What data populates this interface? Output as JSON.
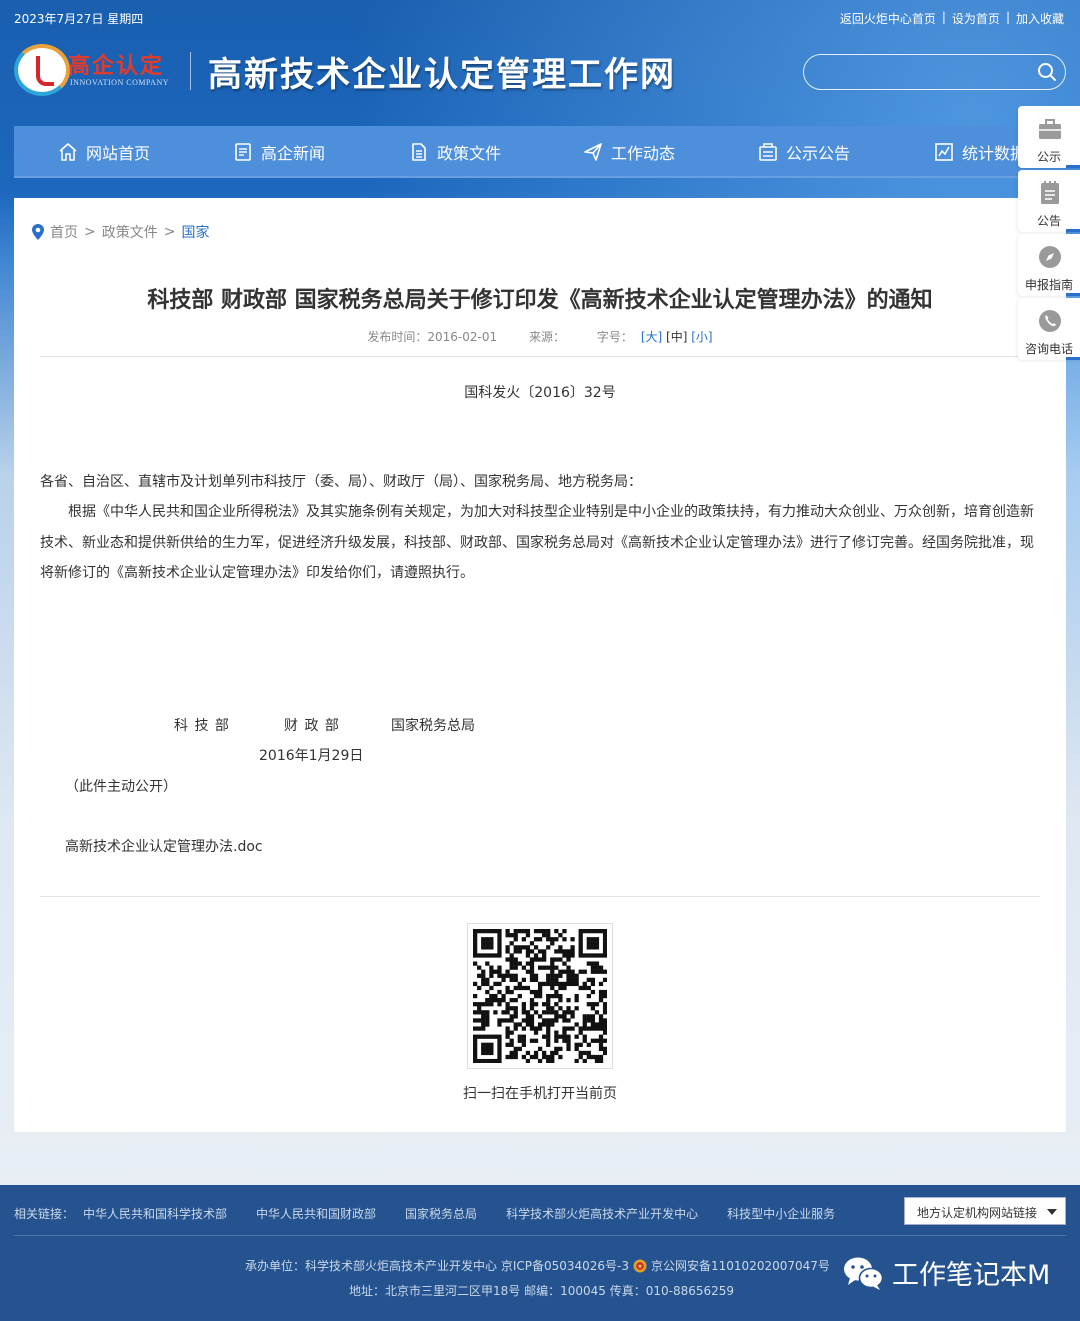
{
  "topbar": {
    "date": "2023年7月27日 星期四",
    "links": [
      "返回火炬中心首页",
      "设为首页",
      "加入收藏"
    ],
    "separator": "|"
  },
  "header": {
    "logo_cn": "高企认定",
    "logo_en": "INNOVATION COMPANY",
    "site_title": "高新技术企业认定管理工作网",
    "search_placeholder": ""
  },
  "nav": {
    "items": [
      {
        "label": "网站首页",
        "icon": "home-icon"
      },
      {
        "label": "高企新闻",
        "icon": "news-icon"
      },
      {
        "label": "政策文件",
        "icon": "document-icon"
      },
      {
        "label": "工作动态",
        "icon": "send-icon"
      },
      {
        "label": "公示公告",
        "icon": "notice-icon"
      },
      {
        "label": "统计数据",
        "icon": "chart-icon"
      }
    ]
  },
  "sidebar": {
    "items": [
      {
        "label": "公示",
        "icon": "briefcase-icon"
      },
      {
        "label": "公告",
        "icon": "clipboard-icon"
      },
      {
        "label": "申报指南",
        "icon": "compass-icon"
      },
      {
        "label": "咨询电话",
        "icon": "phone-icon"
      }
    ]
  },
  "breadcrumb": {
    "home": "首页",
    "section": "政策文件",
    "current": "国家",
    "separator": ">"
  },
  "article": {
    "title": "科技部 财政部 国家税务总局关于修订印发《高新技术企业认定管理办法》的通知",
    "publish_label": "发布时间：",
    "publish_date": "2016-02-01",
    "source_label": "来源：",
    "source": "",
    "font_label": "字号：",
    "font_sizes": [
      "[大]",
      "[中]",
      "[小]"
    ],
    "doc_number": "国科发火〔2016〕32号",
    "salutation": "各省、自治区、直辖市及计划单列市科技厅（委、局）、财政厅（局）、国家税务局、地方税务局：",
    "body": "根据《中华人民共和国企业所得税法》及其实施条例有关规定，为加大对科技型企业特别是中小企业的政策扶持，有力推动大众创业、万众创新，培育创造新技术、新业态和提供新供给的生力军，促进经济升级发展，科技部、财政部、国家税务总局对《高新技术企业认定管理办法》进行了修订完善。经国务院批准，现将新修订的《高新技术企业认定管理办法》印发给你们，请遵照执行。",
    "signatories": [
      "科 技 部",
      "财 政 部",
      "国家税务总局"
    ],
    "sign_date": "2016年1月29日",
    "disclosure": "（此件主动公开）",
    "attachment": "高新技术企业认定管理办法.doc",
    "qr_caption": "扫一扫在手机打开当前页"
  },
  "footer": {
    "links_label": "相关链接：",
    "links": [
      "中华人民共和国科学技术部",
      "中华人民共和国财政部",
      "国家税务总局",
      "科学技术部火炬高技术产业开发中心",
      "科技型中小企业服务"
    ],
    "select_label": "地方认定机构网站链接",
    "line1_pre": "承办单位：科学技术部火炬高技术产业开发中心 京ICP备05034026号-3",
    "line1_post": "京公网安备11010202007047号",
    "line2": "地址：北京市三里河二区甲18号 邮编：100045 传真：010-88656259",
    "watermark": "工作笔记本M"
  },
  "colors": {
    "nav_bg": "#4d8fdb",
    "link_blue": "#2a6fc9",
    "footer_bg": "#24538f"
  }
}
